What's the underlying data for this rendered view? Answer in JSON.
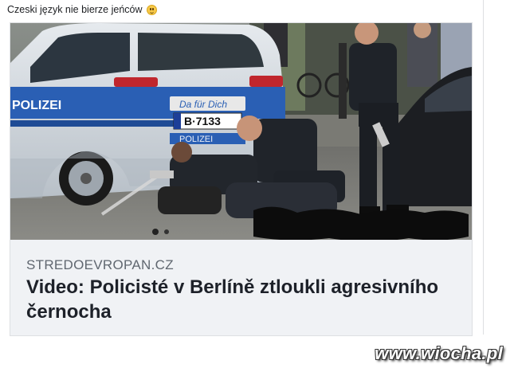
{
  "post": {
    "text": "Czeski język nie bierze jeńców",
    "emoji_icon": "smiling-face-icon"
  },
  "link_card": {
    "photo_texts": {
      "license_plate": "B·7133",
      "door_text": "POLIZEI",
      "side_text": "POLIZEI",
      "dealer_text": "Da für Dich"
    },
    "domain": "STREDOEVROPAN.CZ",
    "headline": "Video: Policisté v Berlíně ztloukli agresivního černocha"
  },
  "watermark": "www.wiocha.pl",
  "colors": {
    "police_blue": "#2a5fb4",
    "police_silver": "#c9d0d8",
    "uniform": "#1f2329",
    "card_bg": "#f0f2f5"
  }
}
